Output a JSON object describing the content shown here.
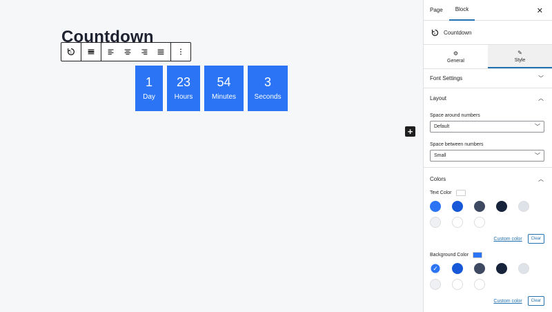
{
  "canvas": {
    "block_title": "Countdown",
    "countdown": [
      {
        "number": "1",
        "label": "Day"
      },
      {
        "number": "23",
        "label": "Hours"
      },
      {
        "number": "54",
        "label": "Minutes"
      },
      {
        "number": "3",
        "label": "Seconds"
      }
    ],
    "inserter_symbol": "+"
  },
  "sidebar": {
    "tabs": {
      "page": "Page",
      "block": "Block"
    },
    "close_symbol": "✕",
    "block_name": "Countdown",
    "subtabs": {
      "general": "General",
      "style": "Style"
    },
    "font_settings": "Font Settings",
    "layout": {
      "title": "Layout",
      "space_around_label": "Space around numbers",
      "space_around_value": "Default",
      "space_between_label": "Space between numbers",
      "space_between_value": "Small"
    },
    "colors": {
      "title": "Colors",
      "text_color_label": "Text Color",
      "text_color_value": "#ffffff",
      "background_color_label": "Background Color",
      "background_color_value": "#2a74f5",
      "palette": [
        "#2a74f5",
        "#1658d8",
        "#3e4a62",
        "#16233a",
        "#dee3e9",
        "#eef0f3",
        "#ffffff",
        "#ffffff"
      ],
      "selected_background_index": 0,
      "custom_color_label": "Custom color",
      "clear_label": "Clear"
    }
  }
}
